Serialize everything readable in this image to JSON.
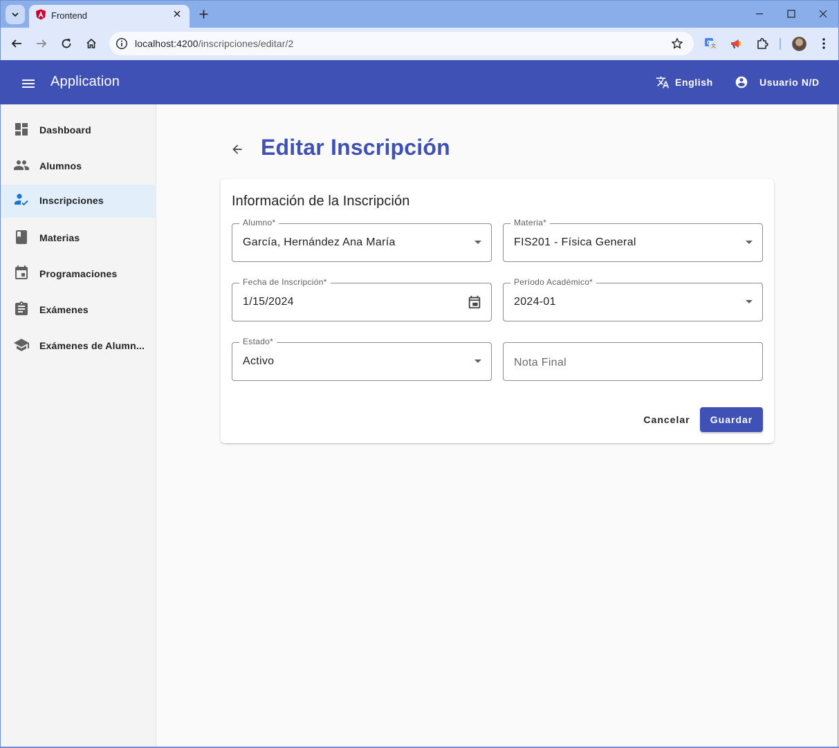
{
  "browser": {
    "tab_title": "Frontend",
    "url_host": "localhost:4200",
    "url_path": "/inscripciones/editar/2"
  },
  "app": {
    "title": "Application",
    "language_label": "English",
    "user_label": "Usuario N/D"
  },
  "sidebar": {
    "items": [
      {
        "label": "Dashboard",
        "icon": "dashboard-icon",
        "active": false
      },
      {
        "label": "Alumnos",
        "icon": "people-icon",
        "active": false
      },
      {
        "label": "Inscripciones",
        "icon": "person-check-icon",
        "active": true
      },
      {
        "label": "Materias",
        "icon": "book-icon",
        "active": false
      },
      {
        "label": "Programaciones",
        "icon": "calendar-icon",
        "active": false
      },
      {
        "label": "Exámenes",
        "icon": "clipboard-icon",
        "active": false
      },
      {
        "label": "Exámenes de Alumn...",
        "icon": "school-icon",
        "active": false
      }
    ]
  },
  "page": {
    "title": "Editar Inscripción",
    "card_title": "Información de la Inscripción"
  },
  "form": {
    "alumno": {
      "label": "Alumno*",
      "value": "García, Hernández Ana María"
    },
    "materia": {
      "label": "Materia*",
      "value": "FIS201 - Física General"
    },
    "fecha": {
      "label": "Fecha de Inscripción*",
      "value": "1/15/2024"
    },
    "periodo": {
      "label": "Período Académico*",
      "value": "2024-01"
    },
    "estado": {
      "label": "Estado*",
      "value": "Activo"
    },
    "nota": {
      "placeholder": "Nota Final"
    }
  },
  "actions": {
    "cancel_label": "Cancelar",
    "save_label": "Guardar"
  },
  "colors": {
    "primary": "#3f51b5",
    "active_nav_bg": "#e2effb",
    "active_icon": "#1976d2"
  }
}
